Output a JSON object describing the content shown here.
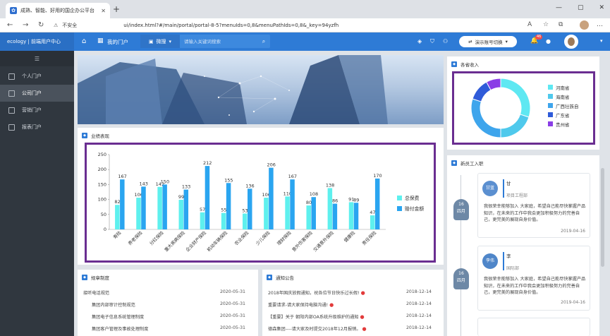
{
  "browser": {
    "tab_title": "成熟、智能、好用的国企办公平台",
    "insecure_label": "不安全",
    "url": "ui/index.html?#/main/portal/portal-8-5?menuIds=0,8&menuPathIds=0,8&_key=94yzfh"
  },
  "header": {
    "brand": "ecology | 前端用户中心",
    "my_portal": "我的门户",
    "search_scope": "微搜",
    "search_placeholder": "请输入关键词搜索",
    "demo_button": "演示账号切换",
    "notif_count": "46"
  },
  "sidebar": {
    "items": [
      {
        "label": "个人门户"
      },
      {
        "label": "公司门户"
      },
      {
        "label": "营销门户"
      },
      {
        "label": "报表门户"
      }
    ]
  },
  "sections": {
    "performance": "业绩表现",
    "income": "各省收入",
    "new_staff": "新员工入职",
    "rules": "规章制度",
    "notice": "通知公告"
  },
  "chart_data": [
    {
      "type": "bar",
      "title": "业绩表现",
      "categories": [
        "寿险",
        "养老保险",
        "分红保险",
        "重大疾病保险",
        "企业财产保险",
        "机动车辆保险",
        "农业保险",
        "少儿保险",
        "理财保险",
        "意外伤害保险",
        "交通意外保险",
        "健康险",
        "责任保险"
      ],
      "series": [
        {
          "name": "总保费",
          "values": [
            82,
            106,
            142,
            99,
            57,
            55,
            53,
            106,
            110,
            80,
            138,
            91,
            47
          ],
          "color": "#5ef0ee"
        },
        {
          "name": "赔付金额",
          "values": [
            167,
            143,
            150,
            133,
            212,
            155,
            136,
            206,
            167,
            108,
            86,
            89,
            170
          ],
          "color": "#2aa5f0"
        }
      ],
      "ylim": [
        0,
        250
      ],
      "yticks": [
        0,
        50,
        100,
        150,
        200,
        250
      ],
      "legend": "right"
    },
    {
      "type": "pie",
      "title": "各省收入",
      "labels": [
        "河南省",
        "海南省",
        "广西壮族自治区",
        "广东省",
        "贵州省"
      ],
      "legend_labels": [
        "河南省",
        "海南省",
        "广西壮族自",
        "广东省",
        "贵州省"
      ],
      "values": [
        30,
        20,
        30,
        12,
        8
      ],
      "colors": [
        "#5ee8f2",
        "#4fc9ec",
        "#3ea5ec",
        "#2f5bd9",
        "#8a3ee6"
      ],
      "legend": "right"
    }
  ],
  "timeline": [
    {
      "day": "16",
      "month": "四月",
      "avatar": "甘蓝",
      "name": "甘",
      "dept": "项目工程部",
      "text": "我很荣幸能够加入    大家庭，希望自己能尽快掌握产品知识，在未来的工作中我会更加积极努力的完善自己，更完美的展现自身价值。",
      "date": "2019-04-16"
    },
    {
      "day": "16",
      "month": "四月",
      "avatar": "李伟",
      "name": "李",
      "dept": "国际部",
      "text": "我很荣幸能够加入    大家庭，希望自己能尽快掌握产品知识，在未来的工作中我会更加积极努力的完善自己，更完美的展现自身价值。",
      "date": "2019-04-16"
    }
  ],
  "rules_list": [
    {
      "title": "接听电话规范",
      "date": "2020-05-31"
    },
    {
      "title": "集团内部审计控制规范",
      "date": "2020-05-31"
    },
    {
      "title": "集团电子信息系统管理制度",
      "date": "2020-05-31"
    },
    {
      "title": "集团客户管理及事故处理制度",
      "date": "2020-05-31"
    }
  ],
  "notice_list": [
    {
      "title": "2018年国庆放假通知，祝各位节日快乐过长假!",
      "date": "2018-12-14"
    },
    {
      "title": "重要请求-请大家保持电脑沟通!",
      "date": "2018-12-14"
    },
    {
      "title": "【重要】关于        朝阳内部OA系统升级维护的通知",
      "date": "2018-12-14"
    },
    {
      "title": "德森集团----请大家及时提交2018年12月报销。",
      "date": "2018-12-14"
    }
  ]
}
